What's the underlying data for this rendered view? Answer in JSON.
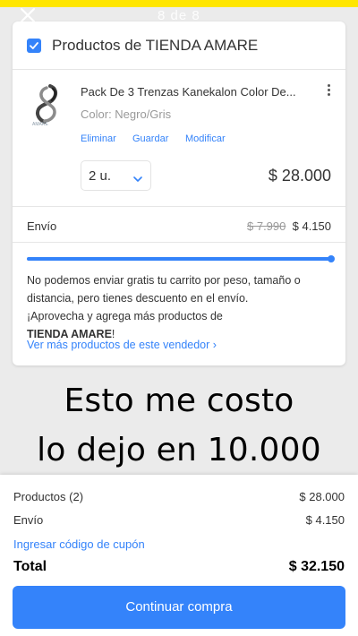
{
  "story": {
    "counter": "8 de 8"
  },
  "cart": {
    "seller_title": "Productos de TIENDA AMARE",
    "product": {
      "title": "Pack De 3 Trenzas Kanekalon Color De...",
      "variant": "Color: Negro/Gris",
      "thumbnail_caption": "AMARE",
      "actions": {
        "remove": "Eliminar",
        "save": "Guardar",
        "modify": "Modificar"
      },
      "quantity": "2 u.",
      "price": "$ 28.000"
    },
    "shipping": {
      "label": "Envío",
      "old_price": "$ 7.990",
      "price": "$ 4.150",
      "progress_fraction": 1.0,
      "message_line1": "No podemos enviar gratis tu carrito por peso, tamaño o distancia, pero tienes descuento en el envío.",
      "message_line2": "¡Aprovecha y agrega más productos de",
      "message_seller": "TIENDA AMARE",
      "message_end": "!"
    },
    "seller_link": "Ver más productos de este vendedor ›"
  },
  "overlay": {
    "line1": "Esto me costo",
    "line2": "lo dejo en 10.000"
  },
  "summary": {
    "products_label": "Productos (2)",
    "products_value": "$ 28.000",
    "shipping_label": "Envío",
    "shipping_value": "$ 4.150",
    "coupon_link": "Ingresar código de cupón",
    "total_label": "Total",
    "total_value": "$ 32.150",
    "continue_label": "Continuar compra"
  },
  "colors": {
    "accent": "#3483fa",
    "brand_yellow": "#ffe600",
    "background": "#ebebeb"
  },
  "icons": [
    "close-icon",
    "checkbox-checked-icon",
    "more-vertical-icon",
    "chevron-down-icon",
    "chevron-right-icon"
  ]
}
